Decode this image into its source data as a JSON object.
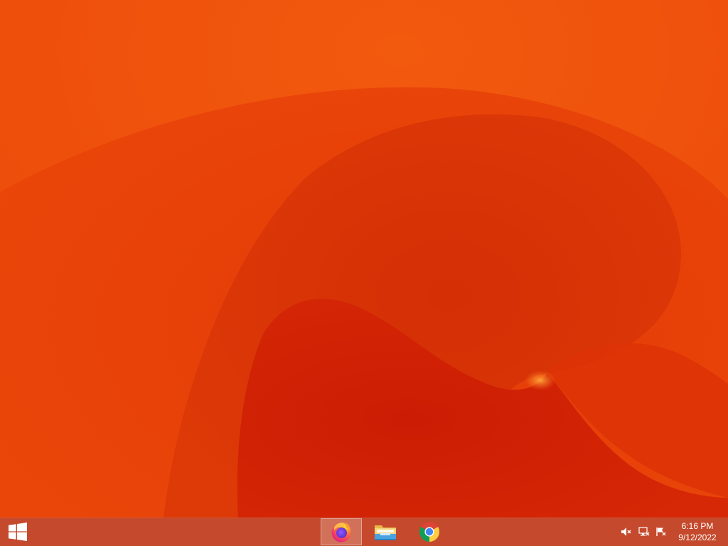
{
  "desktop": {
    "colors": {
      "base": "#ea4a0a",
      "light": "#f36a12",
      "mid": "#e23d08",
      "deep": "#d12a06",
      "core": "#c91e05",
      "glow": "#ffb040"
    }
  },
  "taskbar": {
    "color": "#c5492c",
    "start_icon": "windows-logo-icon",
    "pinned": [
      {
        "name": "Firefox",
        "icon": "firefox-icon",
        "active": true
      },
      {
        "name": "File Explorer",
        "icon": "file-explorer-icon",
        "active": false
      },
      {
        "name": "Google Chrome",
        "icon": "chrome-icon",
        "active": false
      }
    ],
    "tray": {
      "icons": [
        "volume-muted-icon",
        "network-icon",
        "action-center-flag-icon"
      ],
      "time": "6:16 PM",
      "date": "9/12/2022"
    }
  }
}
